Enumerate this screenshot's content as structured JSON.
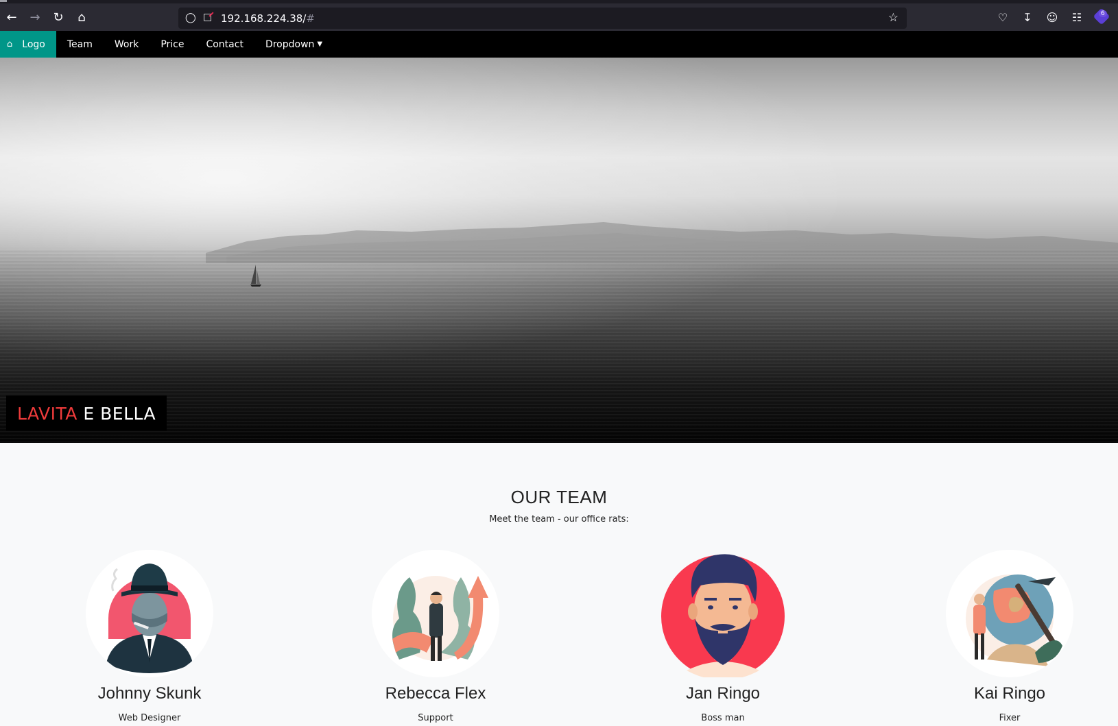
{
  "browser": {
    "url_host": "192.168.224.38/",
    "url_hash": "#",
    "extension_count": "6",
    "icons": {
      "back": "arrow-left-icon",
      "forward": "arrow-right-icon",
      "reload": "reload-icon",
      "home": "home-icon",
      "shield": "shield-icon",
      "lock": "insecure-lock-icon",
      "bookmark": "star-icon",
      "pocket": "pocket-icon",
      "downloads": "download-icon",
      "account": "account-icon",
      "extensions": "puzzle-icon"
    }
  },
  "nav": {
    "logo_label": "Logo",
    "items": [
      "Team",
      "Work",
      "Price",
      "Contact",
      "Dropdown"
    ],
    "accent_color": "#009688"
  },
  "hero": {
    "caption_red": "LAVITA",
    "caption_white": "E BELLA",
    "caption_red_color": "#ef3b3b"
  },
  "team": {
    "title": "OUR TEAM",
    "subtitle": "Meet the team - our office rats:",
    "members": [
      {
        "name": "Johnny Skunk",
        "role": "Web Designer",
        "avatar": "gangster-avatar"
      },
      {
        "name": "Rebecca Flex",
        "role": "Support",
        "avatar": "businessman-growth-avatar"
      },
      {
        "name": "Jan Ringo",
        "role": "Boss man",
        "avatar": "bearded-man-avatar"
      },
      {
        "name": "Kai Ringo",
        "role": "Fixer",
        "avatar": "miner-globe-avatar"
      }
    ]
  }
}
